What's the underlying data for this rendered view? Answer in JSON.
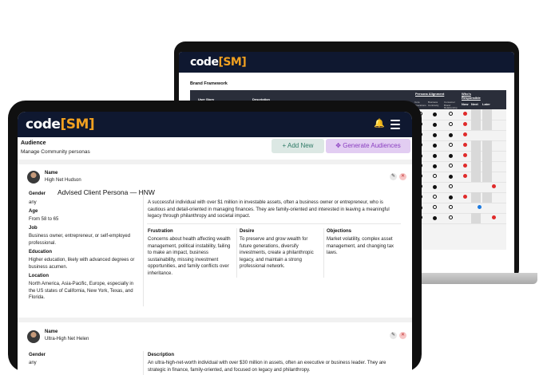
{
  "brand": {
    "logo_main": "code",
    "logo_bracket_open": "[",
    "logo_bracket_text": "SM",
    "logo_bracket_close": "]",
    "accent": "#f0a020",
    "header_bg": "#0f1830"
  },
  "laptop": {
    "section_title": "Brand Framework",
    "table": {
      "group_headers": [
        "Persona Alignment",
        "Who's Responsible"
      ],
      "col_headers": [
        "User Story",
        "Description"
      ],
      "sub_headers": [
        "Core Operations",
        "Business Continuity",
        "Consumer Brand Relationship",
        "Now",
        "Next",
        "Later"
      ]
    }
  },
  "tablet": {
    "audience_title": "Audience",
    "audience_subtitle": "Manage Community personas",
    "add_button": "+ Add New",
    "generate_button": "Generate Audiences",
    "cards": [
      {
        "name_label": "Name",
        "name": "High Net Hudson",
        "persona_title": "Advised Client Persona — HNW",
        "gender_label": "Gender",
        "gender": "any",
        "age_label": "Age",
        "age": "From 58  to 65",
        "job_label": "Job",
        "job": "Business owner, entrepreneur, or self-employed professional.",
        "education_label": "Education",
        "education": "Higher education, likely with advanced degrees or business acumen.",
        "location_label": "Location",
        "location": "North America, Asia-Pacific, Europe, especially in the US states of California, New York, Texas, and Florida.",
        "description": "A successful individual with over $1 million in investable assets, often a business owner or entrepreneur, who is cautious and detail-oriented in managing finances. They are family-oriented and interested in leaving a meaningful legacy through philanthropy and societal impact.",
        "frustration_label": "Frustration",
        "frustration": "Concerns about health affecting wealth management, political instability, failing to make an impact, business sustainability, missing investment opportunities, and family conflicts over inheritance.",
        "desire_label": "Desire",
        "desire": "To preserve and grow wealth for future generations, diversify investments, create a philanthropic legacy, and maintain a strong professional network.",
        "objections_label": "Objections",
        "objections": "Market volatility, complex asset management, and changing tax laws."
      },
      {
        "name_label": "Name",
        "name": "Ultra-High Net Helen",
        "gender_label": "Gender",
        "gender": "any",
        "description_label": "Description",
        "description": "An ultra-high-net-worth individual with over $30 million in assets, often an executive or business leader. They are strategic in finance, family-oriented, and focused on legacy and philanthropy."
      }
    ]
  }
}
